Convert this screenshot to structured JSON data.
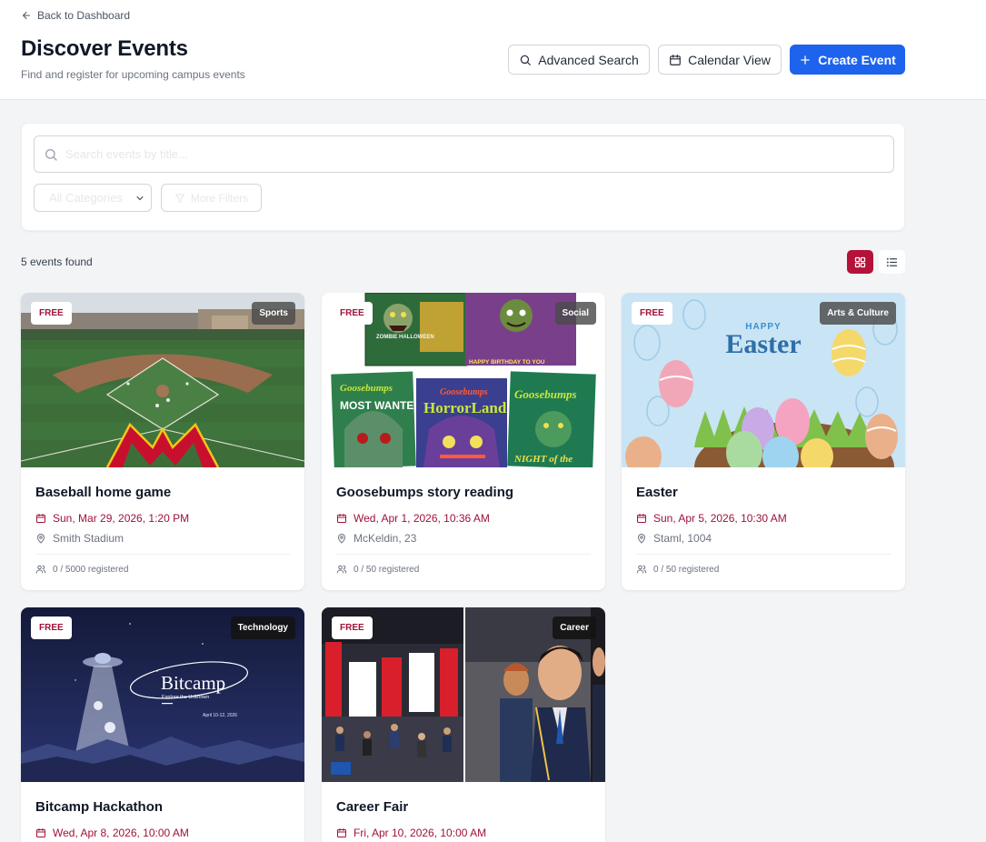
{
  "header": {
    "back_label": "Back to Dashboard",
    "title": "Discover Events",
    "subtitle": "Find and register for upcoming campus events",
    "advanced_search_label": "Advanced Search",
    "calendar_view_label": "Calendar View",
    "create_event_label": "Create Event"
  },
  "filters": {
    "search_placeholder": "Search events by title...",
    "search_value": "",
    "category_selected": "All Categories",
    "more_filters_label": "More Filters"
  },
  "results": {
    "count_label": "5 events found",
    "view_mode": "grid"
  },
  "events": [
    {
      "title": "Baseball home game",
      "date": "Sun, Mar 29, 2026, 1:20 PM",
      "location": "Smith Stadium",
      "registered": "0 / 5000 registered",
      "price_badge": "FREE",
      "category": "Sports",
      "image_icon": "baseball-stadium-image"
    },
    {
      "title": "Goosebumps story reading",
      "date": "Wed, Apr 1, 2026, 10:36 AM",
      "location": "McKeldin, 23",
      "registered": "0 / 50 registered",
      "price_badge": "FREE",
      "category": "Social",
      "image_icon": "goosebumps-books-image",
      "image_text": {
        "book1": "ZOMBIE HALLOWEEN",
        "book2": "HAPPY BIRTHDAY TO YOU",
        "book3_brand": "Goosebumps",
        "book3_title": "MOST WANTED",
        "book4_brand": "Goosebumps",
        "book4_title": "HorrorLand",
        "book5_brand": "Goosebumps",
        "book5_title": "NIGHT of the"
      }
    },
    {
      "title": "Easter",
      "date": "Sun, Apr 5, 2026, 10:30 AM",
      "location": "Staml, 1004",
      "registered": "0 / 50 registered",
      "price_badge": "FREE",
      "category": "Arts & Culture",
      "image_icon": "easter-eggs-image",
      "image_text": {
        "happy": "HAPPY",
        "easter": "Easter"
      }
    },
    {
      "title": "Bitcamp Hackathon",
      "date": "Wed, Apr 8, 2026, 10:00 AM",
      "price_badge": "FREE",
      "category": "Technology",
      "image_icon": "bitcamp-ufo-image",
      "image_text": {
        "logo": "Bitcamp",
        "tagline": "Explore the Unknown",
        "dates": "April 10-12, 2026"
      }
    },
    {
      "title": "Career Fair",
      "date": "Fri, Apr 10, 2026, 10:00 AM",
      "price_badge": "FREE",
      "category": "Career",
      "image_icon": "career-fair-photo-image"
    }
  ],
  "colors": {
    "primary": "#1d63ed",
    "accent": "#b5123a",
    "date_text": "#9f1239",
    "background": "#f3f4f6"
  }
}
